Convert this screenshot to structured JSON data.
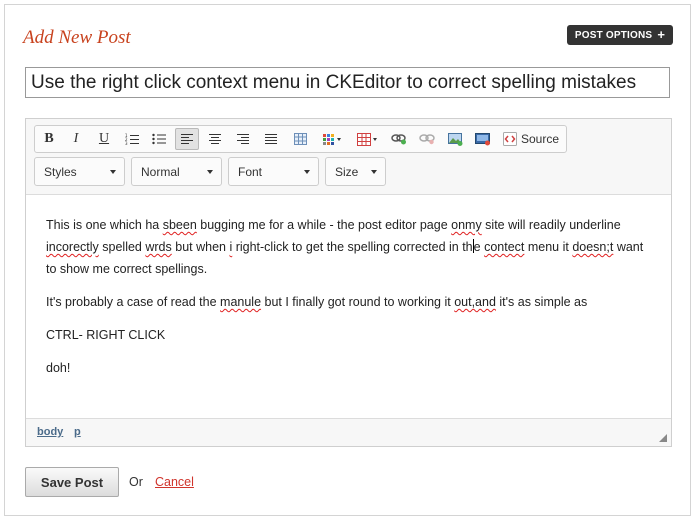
{
  "header": {
    "title": "Add New Post",
    "post_options_label": "POST OPTIONS"
  },
  "post_title": {
    "value": "Use the right click context menu in CKEditor to correct spelling mistakes"
  },
  "toolbar": {
    "source_label": "Source",
    "styles_label": "Styles",
    "format_label": "Normal",
    "font_label": "Font",
    "size_label": "Size"
  },
  "content": {
    "p1": {
      "a": "This is one which ha ",
      "b": "sbeen",
      "c": " bugging me for a while - the post editor page ",
      "d": "onmy",
      "e": " site will readily underline ",
      "f": "incorectly",
      "g": " spelled ",
      "h": "wrds",
      "i": " but when ",
      "j": "i",
      "k": " right-click to get the spelling corrected in th",
      "l": "e ",
      "m": "contect",
      "n": " menu it ",
      "o": "doesn;t",
      "p": " want to show me correct spellings."
    },
    "p2": {
      "a": "It's probably a case of read the ",
      "b": "manule",
      "c": " but I finally got round to working it ",
      "d": "out,and",
      "e": " it's as simple as"
    },
    "p3": "CTRL- RIGHT CLICK",
    "p4": "doh!"
  },
  "statusbar": {
    "path": [
      "body",
      "p"
    ]
  },
  "footer": {
    "save_label": "Save Post",
    "or_label": "Or",
    "cancel_label": "Cancel"
  },
  "colors": {
    "title": "#c8421e",
    "cancel": "#d0342c",
    "options_bg": "#333333"
  },
  "icons": [
    "bold-icon",
    "italic-icon",
    "underline-icon",
    "numbered-list-icon",
    "bullet-list-icon",
    "align-left-icon",
    "align-center-icon",
    "align-right-icon",
    "justify-icon",
    "table-icon",
    "color-grid-icon",
    "insert-table-icon",
    "link-icon",
    "unlink-icon",
    "image-icon",
    "media-icon",
    "source-icon"
  ]
}
